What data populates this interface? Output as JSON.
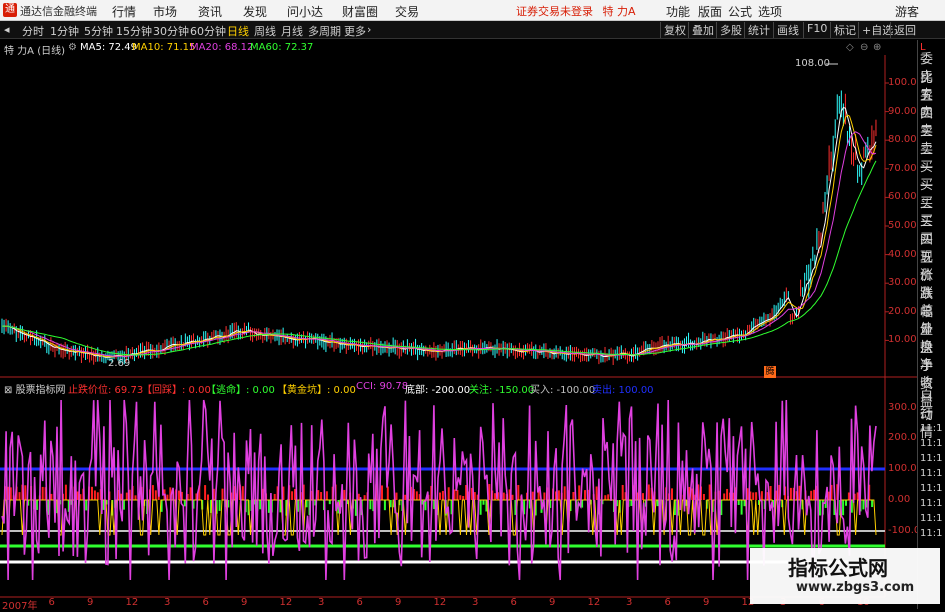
{
  "app": {
    "name": "通达信金融终端",
    "logo_char": "通",
    "login_status": "证券交易未登录",
    "stock_name_title": "特 力A",
    "user": "游客"
  },
  "menu": [
    "行情",
    "市场",
    "资讯",
    "发现",
    "问小达",
    "财富圈",
    "交易"
  ],
  "right_menu": [
    "功能",
    "版面",
    "公式",
    "选项"
  ],
  "periods": [
    "分时",
    "1分钟",
    "5分钟",
    "15分钟",
    "30分钟",
    "60分钟",
    "日线",
    "周线",
    "月线",
    "多周期",
    "更多"
  ],
  "selected_period": "日线",
  "toolbar_right": [
    "复权",
    "叠加",
    "多股",
    "统计",
    "画线",
    "F10",
    "标记",
    "+自选",
    "返回"
  ],
  "main_header": {
    "title": "特 力A (日线)",
    "ma5": "MA5: 72.49",
    "ma10": "MA10: 71.15",
    "ma20": "MA20: 68.12",
    "ma60": "MA60: 72.37"
  },
  "price_axis": [
    "100.00",
    "90.00",
    "80.00",
    "70.00",
    "60.00",
    "50.00",
    "40.00",
    "30.00",
    "20.00",
    "10.00"
  ],
  "high_label": "108.00",
  "low_label": "2.69",
  "marker_label": "腾",
  "indicator_header": {
    "name": "股票指标网",
    "items": [
      {
        "label": "止跌价位: 69.73",
        "color": "#ff3030"
      },
      {
        "label": "【回踩】: 0.00",
        "color": "#ff3030"
      },
      {
        "label": "【逃命】: 0.00",
        "color": "#30ff30"
      },
      {
        "label": "【黄金坑】: 0.00",
        "color": "#ffd000"
      },
      {
        "label": "CCI: 90.78",
        "color": "#e040e0"
      },
      {
        "label": "底部: -200.00",
        "color": "#ffffff"
      },
      {
        "label": "关注: -150.00",
        "color": "#30ff30"
      },
      {
        "label": "买入: -100.00",
        "color": "#c0c0c0"
      },
      {
        "label": "卖出: 100.00",
        "color": "#2030ff"
      }
    ]
  },
  "indicator_axis": [
    "300.00",
    "200.00",
    "100.00",
    "0.00",
    "-100.00"
  ],
  "x_axis": [
    "2007年",
    "6",
    "9",
    "12",
    "3",
    "6",
    "9",
    "12",
    "3",
    "6",
    "9",
    "12",
    "3",
    "6",
    "9",
    "12",
    "3",
    "6",
    "9",
    "12",
    "3",
    "6",
    "10"
  ],
  "right_panel": [
    "L",
    "委比",
    "卖五",
    "卖四",
    "卖三",
    "卖二",
    "卖一",
    "买一",
    "买二",
    "买三",
    "买四",
    "买五",
    "现价",
    "涨跌",
    "涨幅",
    "总量",
    "外盘",
    "换手",
    "净资",
    "收益",
    "自动",
    "行情",
    "11:1",
    "11:1",
    "11:1",
    "11:1",
    "11:1",
    "11:1",
    "11:1",
    "11:1"
  ],
  "watermark": {
    "line1": "指标公式网",
    "line2": "www.zbgs3.com"
  },
  "colors": {
    "bg": "#000000",
    "up": "#ff3030",
    "ma5": "#ffffff",
    "ma10": "#ffd000",
    "ma20": "#e040e0",
    "ma60": "#30ff30",
    "cci": "#e040e0",
    "sell_line": "#2030ff",
    "buy_line": "#c0c0c0",
    "focus_line": "#30ff30",
    "bottom_line": "#ffffff"
  }
}
